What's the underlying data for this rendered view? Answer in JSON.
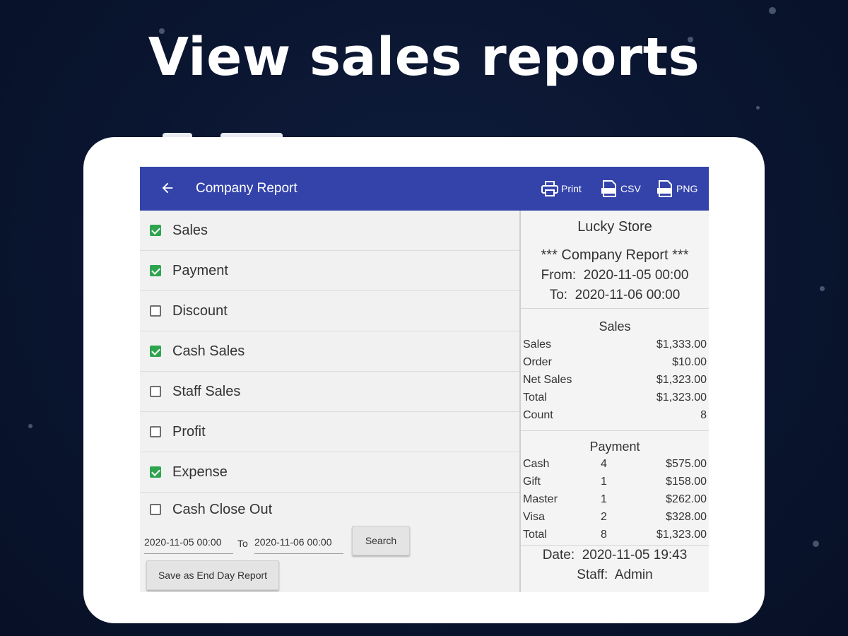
{
  "headline": "View sales reports",
  "app": {
    "title": "Company Report",
    "actions": [
      {
        "label": "Print",
        "icon": "printer-icon"
      },
      {
        "label": "CSV",
        "icon": "csv-file-icon"
      },
      {
        "label": "PNG",
        "icon": "png-file-icon"
      }
    ],
    "colors": {
      "appbar": "#3443aa",
      "checked": "#2fa44f"
    }
  },
  "options": [
    {
      "label": "Sales",
      "checked": true
    },
    {
      "label": "Payment",
      "checked": true
    },
    {
      "label": "Discount",
      "checked": false
    },
    {
      "label": "Cash Sales",
      "checked": true
    },
    {
      "label": "Staff Sales",
      "checked": false
    },
    {
      "label": "Profit",
      "checked": false
    },
    {
      "label": "Expense",
      "checked": true
    },
    {
      "label": "Cash Close Out",
      "checked": false
    }
  ],
  "filters": {
    "from_value": "2020-11-05 00:00",
    "to_label": "To",
    "to_value": "2020-11-06 00:00",
    "search_label": "Search",
    "save_label": "Save as End Day Report"
  },
  "report": {
    "store": "Lucky Store",
    "title": "*** Company Report ***",
    "from_label": "From:",
    "from_value": "2020-11-05 00:00",
    "to_label": "To:",
    "to_value": "2020-11-06 00:00",
    "sales": {
      "heading": "Sales",
      "rows": [
        {
          "key": "Sales",
          "value": "$1,333.00"
        },
        {
          "key": "Order",
          "value": "$10.00"
        },
        {
          "key": "Net Sales",
          "value": "$1,323.00"
        },
        {
          "key": "Total",
          "value": "$1,323.00"
        },
        {
          "key": "Count",
          "value": "8"
        }
      ]
    },
    "payment": {
      "heading": "Payment",
      "rows": [
        {
          "key": "Cash",
          "count": "4",
          "value": "$575.00"
        },
        {
          "key": "Gift",
          "count": "1",
          "value": "$158.00"
        },
        {
          "key": "Master",
          "count": "1",
          "value": "$262.00"
        },
        {
          "key": "Visa",
          "count": "2",
          "value": "$328.00"
        },
        {
          "key": "Total",
          "count": "8",
          "value": "$1,323.00"
        }
      ]
    },
    "date_label": "Date:",
    "date_value": "2020-11-05 19:43",
    "staff_label": "Staff:",
    "staff_value": "Admin"
  }
}
